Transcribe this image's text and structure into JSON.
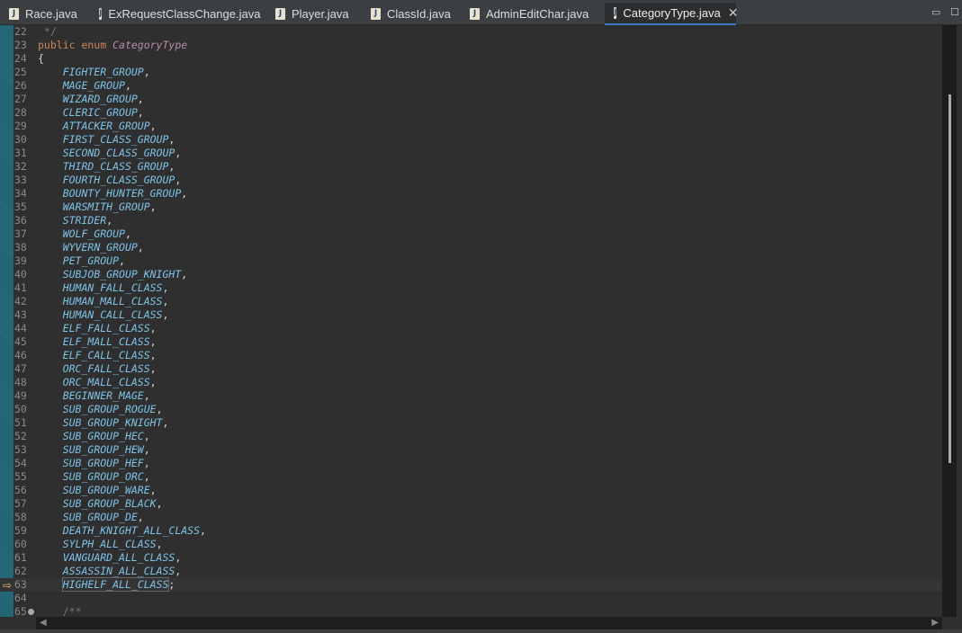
{
  "tabs": [
    {
      "label": "Race.java",
      "icon": "java-file-icon"
    },
    {
      "label": "ExRequestClassChange.java",
      "icon": "java-file-icon"
    },
    {
      "label": "Player.java",
      "icon": "java-file-icon"
    },
    {
      "label": "ClassId.java",
      "icon": "java-file-icon"
    },
    {
      "label": "AdminEditChar.java",
      "icon": "java-file-icon"
    },
    {
      "label": "CategoryType.java",
      "icon": "java-file-icon",
      "active": true
    }
  ],
  "window_buttons": {
    "minimize": "▭",
    "maximize": "☐"
  },
  "editor": {
    "first_line": 22,
    "declaration": {
      "keywords": "public enum ",
      "name": "CategoryType"
    },
    "open_brace": "{",
    "constants": [
      "FIGHTER_GROUP",
      "MAGE_GROUP",
      "WIZARD_GROUP",
      "CLERIC_GROUP",
      "ATTACKER_GROUP",
      "FIRST_CLASS_GROUP",
      "SECOND_CLASS_GROUP",
      "THIRD_CLASS_GROUP",
      "FOURTH_CLASS_GROUP",
      "BOUNTY_HUNTER_GROUP",
      "WARSMITH_GROUP",
      "STRIDER",
      "WOLF_GROUP",
      "WYVERN_GROUP",
      "PET_GROUP",
      "SUBJOB_GROUP_KNIGHT",
      "HUMAN_FALL_CLASS",
      "HUMAN_MALL_CLASS",
      "HUMAN_CALL_CLASS",
      "ELF_FALL_CLASS",
      "ELF_MALL_CLASS",
      "ELF_CALL_CLASS",
      "ORC_FALL_CLASS",
      "ORC_MALL_CLASS",
      "BEGINNER_MAGE",
      "SUB_GROUP_ROGUE",
      "SUB_GROUP_KNIGHT",
      "SUB_GROUP_HEC",
      "SUB_GROUP_HEW",
      "SUB_GROUP_HEF",
      "SUB_GROUP_ORC",
      "SUB_GROUP_WARE",
      "SUB_GROUP_BLACK",
      "SUB_GROUP_DE",
      "DEATH_KNIGHT_ALL_CLASS",
      "SYLPH_ALL_CLASS",
      "VANGUARD_ALL_CLASS",
      "ASSASSIN_ALL_CLASS",
      "HIGHELF_ALL_CLASS"
    ],
    "comment_start": "/**",
    "current_line": 63
  }
}
